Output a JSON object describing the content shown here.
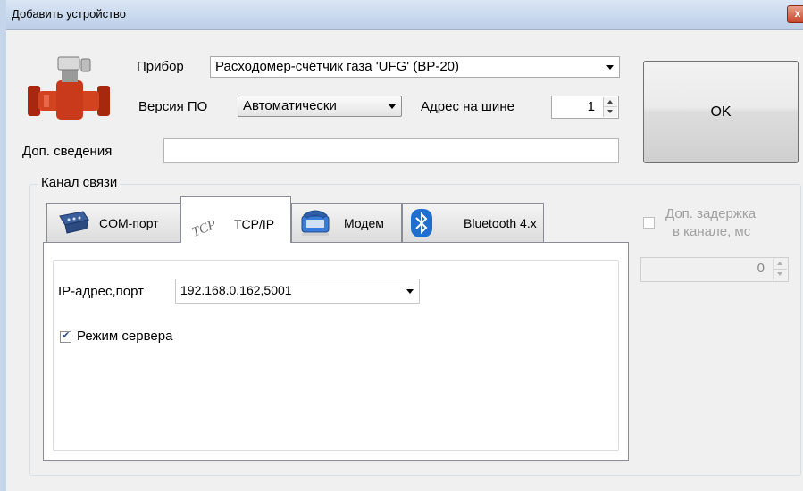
{
  "window": {
    "title": "Добавить устройство",
    "close_glyph": "x"
  },
  "device": {
    "label": "Прибор",
    "value": "Расходомер-счётчик газа 'UFG' (ВР-20)",
    "icon": "flowmeter-icon"
  },
  "firmware": {
    "label": "Версия ПО",
    "value": "Автоматически"
  },
  "bus_address": {
    "label": "Адрес на шине",
    "value": "1"
  },
  "extra_info": {
    "label": "Доп. сведения",
    "value": ""
  },
  "ok_button": {
    "label": "OK"
  },
  "channel": {
    "group_title": "Канал связи",
    "tabs": [
      {
        "label": "COM-порт",
        "icon": "serial-port-icon"
      },
      {
        "label": "TCP/IP",
        "icon": "tcp-icon",
        "icon_text": "TCP",
        "active": true
      },
      {
        "label": "Модем",
        "icon": "telephone-modem-icon"
      },
      {
        "label": "Bluetooth 4.x",
        "icon": "bluetooth-icon"
      }
    ],
    "ip_port": {
      "label": "IP-адрес,порт",
      "value": "192.168.0.162,5001"
    },
    "server_mode": {
      "label": "Режим сервера",
      "checked": true
    }
  },
  "delay": {
    "label_line1": "Доп. задержка",
    "label_line2": "в канале, мс",
    "checked": false,
    "enabled": false,
    "value": "0"
  },
  "colors": {
    "titlebar": "#c9d9ee",
    "dialog_bg": "#f0f0f0",
    "bluetooth": "#1f6fd1",
    "flowmeter": "#c9391c"
  }
}
